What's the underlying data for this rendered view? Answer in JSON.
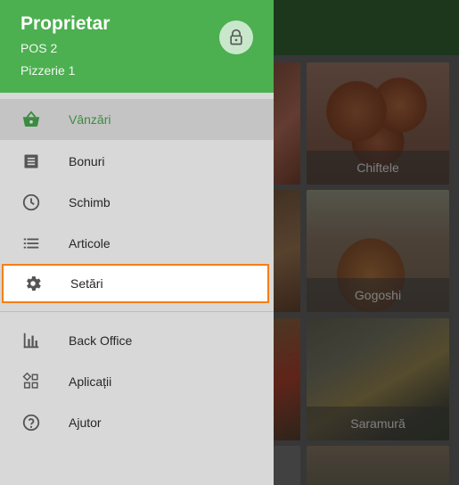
{
  "header": {
    "title": "Proprietar",
    "pos": "POS 2",
    "store": "Pizzerie 1",
    "lock_icon": "lock-icon"
  },
  "menu": {
    "items": [
      {
        "label": "Vânzări",
        "icon": "basket-icon",
        "state": "active"
      },
      {
        "label": "Bonuri",
        "icon": "receipt-icon"
      },
      {
        "label": "Schimb",
        "icon": "clock-icon"
      },
      {
        "label": "Articole",
        "icon": "list-icon"
      },
      {
        "label": "Setări",
        "icon": "gear-icon",
        "state": "highlighted"
      },
      {
        "label": "Back Office",
        "icon": "bar-chart-icon"
      },
      {
        "label": "Aplicații",
        "icon": "apps-icon"
      },
      {
        "label": "Ajutor",
        "icon": "help-icon"
      }
    ]
  },
  "products": [
    {
      "name": "Chiftele"
    },
    {
      "name": "Gogoshi"
    },
    {
      "name": "Saramură"
    }
  ],
  "colors": {
    "header_green": "#4caf50",
    "active_green": "#3d8b40",
    "highlight_orange": "#f57f17"
  }
}
